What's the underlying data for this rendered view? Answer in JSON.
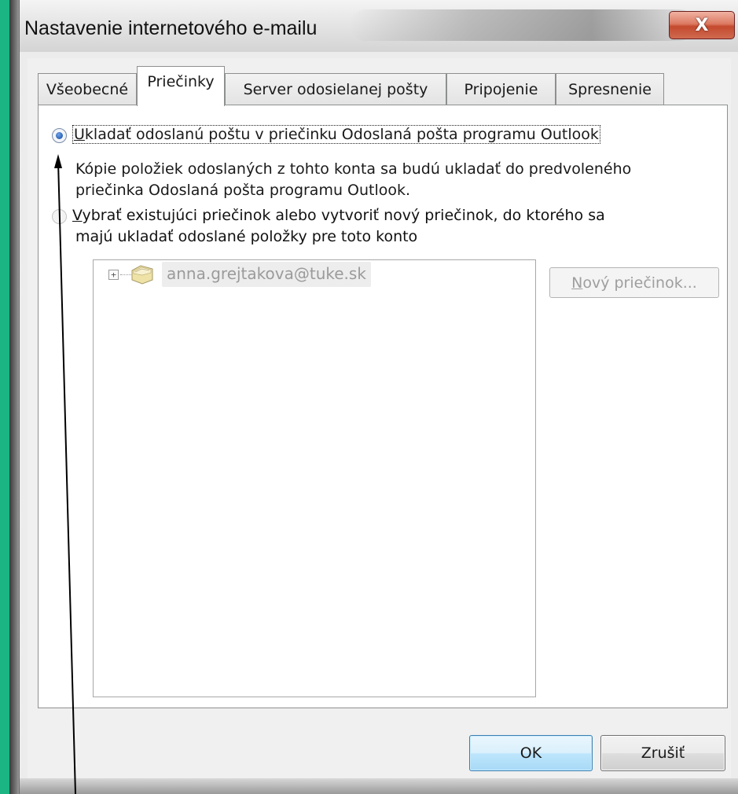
{
  "window": {
    "title": "Nastavenie internetového e-mailu",
    "close_glyph": "X"
  },
  "tabs": [
    {
      "label": "Všeobecné",
      "active": false
    },
    {
      "label": "Priečinky",
      "active": true
    },
    {
      "label": "Server odosielanej pošty",
      "active": false
    },
    {
      "label": "Pripojenie",
      "active": false
    },
    {
      "label": "Spresnenie",
      "active": false
    }
  ],
  "options": {
    "save_default": {
      "underlined_char": "U",
      "label_rest": "kladať odoslanú poštu v priečinku Odoslaná pošta programu Outlook",
      "selected": true,
      "description_line1": "Kópie položiek odoslaných z tohto konta sa budú ukladať do predvoleného",
      "description_line2": "priečinka Odoslaná pošta programu Outlook."
    },
    "choose_folder": {
      "underlined_char": "V",
      "label_line1_rest": "ybrať existujúci priečinok alebo vytvoriť nový priečinok, do ktorého sa",
      "label_line2": "majú ukladať odoslané položky pre toto konto",
      "selected": false,
      "disabled": true
    }
  },
  "folder_tree": {
    "expander_glyph": "+",
    "account": "anna.grejtakova@tuke.sk"
  },
  "buttons": {
    "new_folder_underlined": "N",
    "new_folder_rest": "ový priečinok...",
    "ok": "OK",
    "cancel": "Zrušiť"
  },
  "colors": {
    "side_band": "#1ab583",
    "radio_selected": "#2a62b6",
    "close_button": "#c44a2e",
    "ok_button_border": "#3c7fb1"
  },
  "icons": {
    "close": "close-icon",
    "folder": "mail-folder-icon",
    "expander": "tree-expand-icon",
    "annotation": "annotation-arrow-icon"
  }
}
